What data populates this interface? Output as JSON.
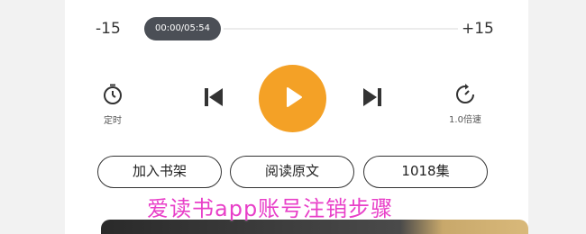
{
  "player": {
    "skip_back": "-15",
    "skip_forward": "+15",
    "time": "00:00/05:54",
    "progress": 0
  },
  "controls": {
    "timer_label": "定时",
    "speed_label": "1.0倍速"
  },
  "actions": {
    "add_shelf": "加入书架",
    "read_original": "阅读原文",
    "episodes": "1018集"
  },
  "overlay": {
    "watermark": "爱读书app账号注销步骤"
  },
  "colors": {
    "accent": "#f4a126",
    "time_pill": "#4b4f56",
    "watermark": "#e83fc8"
  },
  "icons": [
    "timer-icon",
    "previous-icon",
    "play-icon",
    "next-icon",
    "speed-icon"
  ]
}
